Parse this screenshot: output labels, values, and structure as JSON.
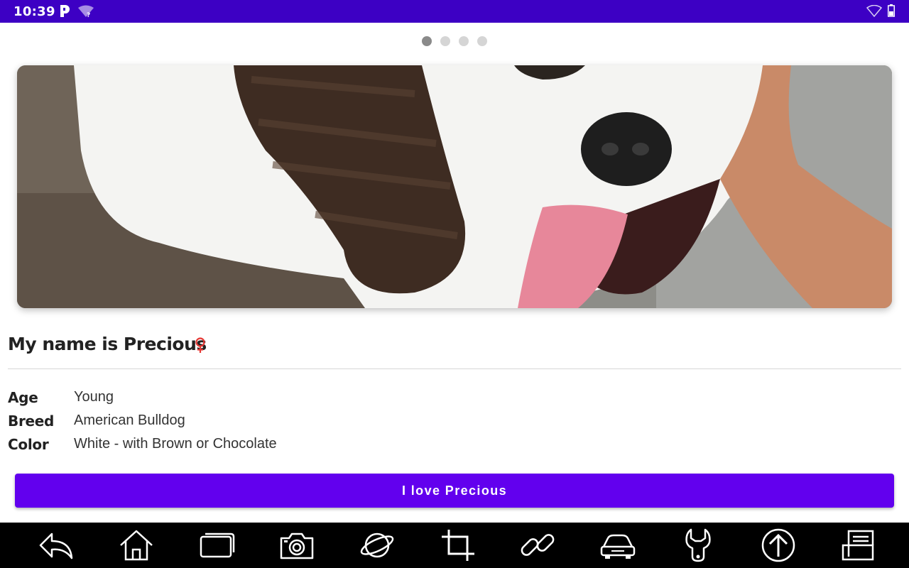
{
  "status_bar": {
    "time": "10:39",
    "background_color": "#3d00c4",
    "icons": [
      "parking-app-icon",
      "wifi-question-icon",
      "wifi-icon",
      "battery-icon"
    ]
  },
  "pager": {
    "page_count": 4,
    "current_index": 0
  },
  "pet": {
    "photo_subject": "dog-photo",
    "name_title": "My name is Precious",
    "gender_icon": "female-icon",
    "gender_color": "#e53935",
    "details": [
      {
        "label": "Age",
        "value": "Young"
      },
      {
        "label": "Breed",
        "value": "American Bulldog"
      },
      {
        "label": "Color",
        "value": "White - with Brown or Chocolate"
      }
    ]
  },
  "action": {
    "love_label": "I love Precious",
    "color": "#6200ee"
  },
  "nav_bar": {
    "icons": [
      "back-icon",
      "home-icon",
      "recent-apps-icon",
      "camera-icon",
      "browser-planet-icon",
      "crop-icon",
      "link-icon",
      "car-icon",
      "wrench-icon",
      "upload-icon",
      "document-icon"
    ]
  }
}
